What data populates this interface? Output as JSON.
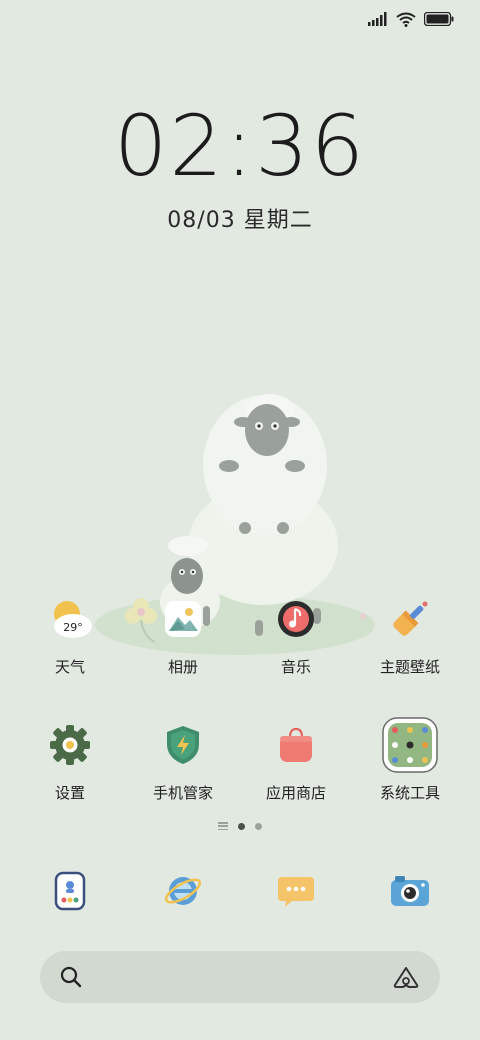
{
  "status_bar": {
    "signal_icon": "signal-bars-icon",
    "wifi_icon": "wifi-icon",
    "battery_icon": "battery-full-icon"
  },
  "clock": {
    "time": "02:36",
    "date": "08/03 星期二"
  },
  "apps": [
    {
      "label": "天气",
      "icon": "weather-icon",
      "badge": "29°"
    },
    {
      "label": "相册",
      "icon": "gallery-icon"
    },
    {
      "label": "音乐",
      "icon": "music-icon"
    },
    {
      "label": "主题壁纸",
      "icon": "themes-icon"
    },
    {
      "label": "设置",
      "icon": "settings-icon"
    },
    {
      "label": "手机管家",
      "icon": "security-icon"
    },
    {
      "label": "应用商店",
      "icon": "app-store-icon"
    },
    {
      "label": "系统工具",
      "icon": "system-tools-folder-icon"
    }
  ],
  "page_indicator": {
    "pages": 2,
    "active": 1
  },
  "dock": [
    {
      "icon": "phone-icon"
    },
    {
      "icon": "browser-icon"
    },
    {
      "icon": "messages-icon"
    },
    {
      "icon": "camera-icon"
    }
  ],
  "search": {
    "search_icon": "search-icon",
    "assistant_icon": "assistant-icon"
  }
}
